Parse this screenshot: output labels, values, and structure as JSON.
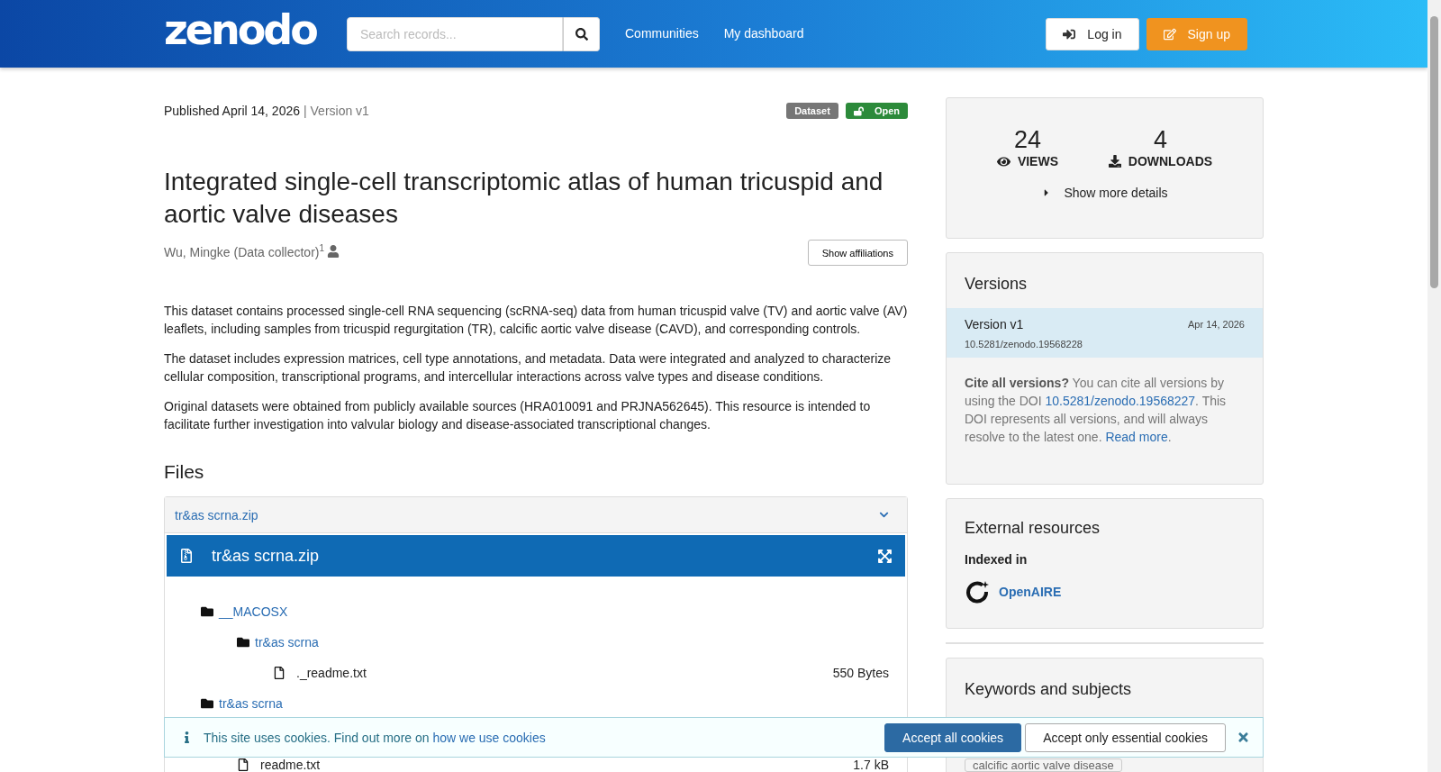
{
  "header": {
    "logo": "zenodo",
    "search": {
      "placeholder": "Search records..."
    },
    "nav": [
      "Communities",
      "My dashboard"
    ],
    "login": "Log in",
    "signup": "Sign up"
  },
  "record": {
    "published": "Published April 14, 2026",
    "version": "| Version v1",
    "badges": [
      {
        "label": "Dataset",
        "kind": "type"
      },
      {
        "label": "Open",
        "kind": "access"
      }
    ],
    "title": "Integrated single-cell transcriptomic atlas of human tricuspid and aortic valve diseases",
    "creators": [
      {
        "name": "Wu, Mingke (Data collector)$^{1}$"
      }
    ],
    "show_affiliations": "Show affiliations",
    "description": [
      "This dataset contains processed single-cell RNA sequencing (scRNA-seq) data from human tricuspid valve (TV) and aortic valve (AV) leaflets, including samples from tricuspid regurgitation (TR), calcific aortic valve disease (CAVD), and corresponding controls.",
      "The dataset includes expression matrices, cell type annotations, and metadata. Data were integrated and analyzed to characterize cellular composition, transcriptional programs, and intercellular interactions across valve types and disease conditions.",
      "Original datasets were obtained from publicly available sources (HRA010091 and PRJNA562645). This resource is intended to facilitate further investigation into valvular biology and disease-associated transcriptional changes."
    ]
  },
  "files": {
    "heading": "Files",
    "accordion_title": "tr&as scrna.zip",
    "expanded": true,
    "preview_title": "tr&as scrna.zip",
    "tree": [
      {
        "kind": "folder",
        "name": "__MACOSX",
        "children": [
          {
            "kind": "folder",
            "name": "tr&as scrna",
            "children": [
              {
                "kind": "file",
                "name": "._readme.txt",
                "size": "550 Bytes"
              }
            ]
          }
        ]
      },
      {
        "kind": "folder",
        "name": "tr&as scrna",
        "children": [
          {
            "kind": "file",
            "name": "readme.txt",
            "size": "1.7 kB"
          }
        ]
      }
    ]
  },
  "stats": {
    "views": "24",
    "views_label": "VIEWS",
    "downloads": "4",
    "downloads_label": "DOWNLOADS",
    "more": "Show more details"
  },
  "versions": {
    "heading": "Versions",
    "items": [
      {
        "label": "Version v1",
        "date": "Apr 14, 2026",
        "doi": "10.5281/zenodo.19568228",
        "selected": true
      }
    ],
    "cite": [
      {
        "kind": "text",
        "text": "**Cite all versions?** You can cite all versions by using the DOI "
      },
      {
        "kind": "link",
        "text": "10.5281/zenodo.19568227"
      },
      {
        "kind": "text",
        "text": ". This DOI represents all versions, and will always resolve to the latest one. "
      },
      {
        "kind": "link",
        "text": "Read more"
      },
      {
        "kind": "text",
        "text": "."
      }
    ]
  },
  "external": {
    "heading": "External resources",
    "subheading": "Indexed in",
    "items": [
      {
        "name": "OpenAIRE"
      }
    ]
  },
  "keywords": {
    "heading": "Keywords and subjects",
    "tags": [
      "calcific aortic valve disease"
    ]
  },
  "cookies": {
    "message": [
      {
        "kind": "text",
        "text": "This site uses cookies. Find out more on "
      },
      {
        "kind": "link",
        "text": "how we use cookies"
      }
    ],
    "accept_all": "Accept all cookies",
    "accept_essential": "Accept only essential cookies"
  }
}
